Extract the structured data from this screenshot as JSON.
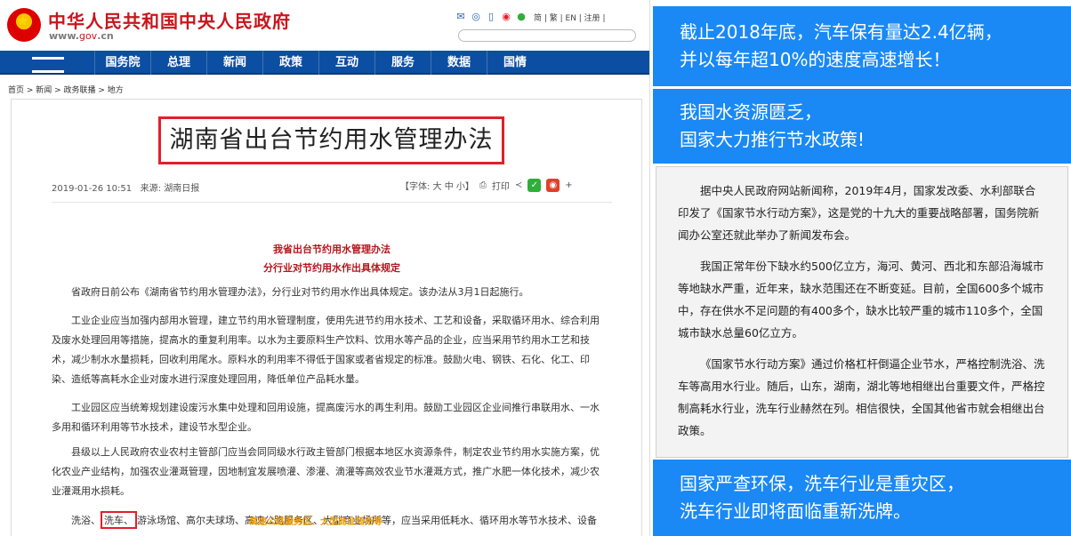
{
  "header": {
    "site_title": "中华人民共和国中央人民政府",
    "site_url_prefix": "www.",
    "site_url_brand": "gov",
    "site_url_suffix": ".cn",
    "top_links": "简 | 繁 | EN | 注册 |"
  },
  "nav": {
    "items": [
      "国务院",
      "总理",
      "新闻",
      "政策",
      "互动",
      "服务",
      "数据",
      "国情"
    ]
  },
  "breadcrumb": "首页 > 新闻 > 政务联播 > 地方",
  "article": {
    "title": "湖南省出台节约用水管理办法",
    "date": "2019-01-26 10:51",
    "source": "来源: 湖南日报",
    "font_size_label": "【字体: 大 中 小】",
    "print_label": "打印",
    "subheading_1": "我省出台节约用水管理办法",
    "subheading_2": "分行业对节约用水作出具体规定",
    "para_1": "省政府日前公布《湖南省节约用水管理办法》，分行业对节约用水作出具体规定。该办法从3月1日起施行。",
    "para_2": "工业企业应当加强内部用水管理，建立节约用水管理制度，使用先进节约用水技术、工艺和设备，采取循环用水、综合利用及废水处理回用等措施，提高水的重复利用率。以水为主要原料生产饮料、饮用水等产品的企业，应当采用节约用水工艺和技术，减少制水水量损耗，回收利用尾水。原料水的利用率不得低于国家或者省规定的标准。鼓励火电、钢铁、石化、化工、印染、造纸等高耗水企业对废水进行深度处理回用，降低单位产品耗水量。",
    "para_3": "工业园区应当统筹规划建设废污水集中处理和回用设施，提高废污水的再生利用。鼓励工业园区企业间推行串联用水、一水多用和循环利用等节水技术，建设节水型企业。",
    "para_4": "县级以上人民政府农业农村主管部门应当会同同级水行政主管部门根据本地区水资源条件，制定农业节约用水实施方案，优化农业产业结构，加强农业灌溉管理，因地制宜发展喷灌、渗灌、滴灌等高效农业节水灌溉方式，推广水肥一体化技术，减少农业灌溉用水损耗。",
    "bottom_prefix": "洗浴、",
    "bottom_highlight": "洗车、",
    "bottom_rest": "游泳场馆、高尔夫球场、高速公路服务区、大型商业场所等，应当采用低耗水、循环用水等节水技术、设备",
    "stamp_text": "高速公路服务区、大型商业场所等"
  },
  "panel": {
    "box_1": "截止2018年底，汽车保有量达2.4亿辆，\n并以每年超10%的速度高速增长！",
    "box_2": "我国水资源匮乏，\n国家大力推行节水政策!",
    "para_1": "据中央人民政府网站新闻称，2019年4月，国家发改委、水利部联合印发了《国家节水行动方案》，这是党的十九大的重要战略部署，国务院新闻办公室还就此举办了新闻发布会。",
    "para_2": "我国正常年份下缺水约500亿立方，海河、黄河、西北和东部沿海城市等地缺水严重，近年来，缺水范围还在不断变延。目前，全国600多个城市中，存在供水不足问题的有400多个，缺水比较严重的城市110多个，全国城市缺水总量60亿立方。",
    "para_3": "《国家节水行动方案》通过价格杠杆倒逼企业节水，严格控制洗浴、洗车等高用水行业。随后，山东，湖南，湖北等地相继出台重要文件，严格控制高耗水行业，洗车行业赫然在列。相信很快，全国其他省市就会相继出台政策。",
    "box_3": "国家严查环保，洗车行业是重灾区，\n洗车行业即将面临重新洗牌。"
  },
  "colors": {
    "brand_red": "#c8161d",
    "nav_blue": "#0c4ea2",
    "panel_blue": "#1a89f5",
    "highlight_red": "#e0202a"
  }
}
